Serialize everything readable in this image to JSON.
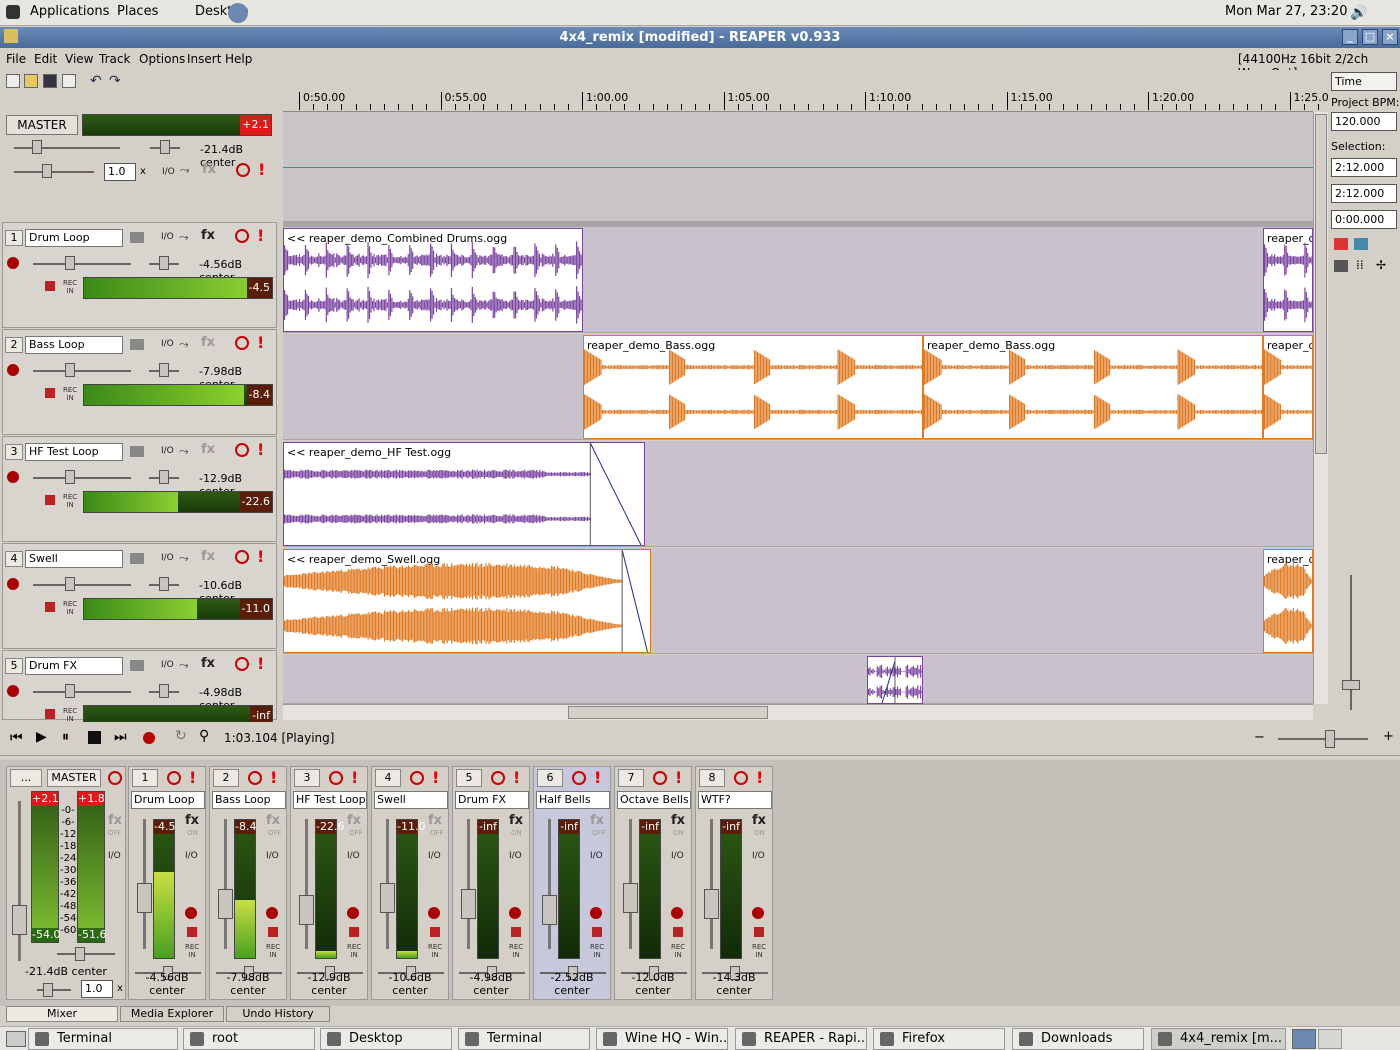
{
  "topbar": {
    "applications": "Applications",
    "places": "Places",
    "desktop": "Desktop",
    "clock": "Mon Mar 27, 23:20"
  },
  "window": {
    "title": "4x4_remix [modified] - REAPER v0.933"
  },
  "menu": {
    "file": "File",
    "edit": "Edit",
    "view": "View",
    "track": "Track",
    "options": "Options",
    "insert": "Insert",
    "help": "Help",
    "audio_info": "[44100Hz 16bit 2/2ch WaveOut]"
  },
  "ruler": {
    "labels": [
      "0:50.00",
      "0:55.00",
      "1:00.00",
      "1:05.00",
      "1:10.00",
      "1:15.00",
      "1:20.00",
      "1:25.00"
    ]
  },
  "right": {
    "mode": "Time",
    "bpm_label": "Project BPM:",
    "bpm": "120.000",
    "selection_label": "Selection:",
    "sel_start": "2:12.000",
    "sel_end": "2:12.000",
    "sel_len": "0:00.000"
  },
  "master": {
    "label": "MASTER",
    "meter": "+2.1",
    "vol": "-21.4dB center",
    "rate": "1.0",
    "x": "x"
  },
  "tracks": [
    {
      "num": "1",
      "name": "Drum Loop",
      "vol": "-4.56dB center",
      "meter": "-4.5",
      "level": 0.9
    },
    {
      "num": "2",
      "name": "Bass Loop",
      "vol": "-7.98dB center",
      "meter": "-8.4",
      "level": 0.85
    },
    {
      "num": "3",
      "name": "HF Test Loop",
      "vol": "-12.9dB center",
      "meter": "-22.6",
      "level": 0.5
    },
    {
      "num": "4",
      "name": "Swell",
      "vol": "-10.6dB center",
      "meter": "-11.0",
      "level": 0.6
    },
    {
      "num": "5",
      "name": "Drum FX",
      "vol": "-4.98dB center",
      "meter": "-inf",
      "level": 0.0
    }
  ],
  "items": {
    "drums": "<< reaper_demo_Combined Drums.ogg",
    "drums_r": "reaper_de",
    "bass1": "reaper_demo_Bass.ogg",
    "bass2": "reaper_demo_Bass.ogg",
    "bass_r": "reaper_de",
    "hf": "<< reaper_demo_HF Test.ogg",
    "swell": "<< reaper_demo_Swell.ogg",
    "swell_r": "reaper_de"
  },
  "transport": {
    "position": "1:03.104 [Playing]"
  },
  "mixer": {
    "master": {
      "btn": "...",
      "label": "MASTER",
      "meter_l": "+2.1",
      "meter_r": "+1.8",
      "scale": [
        "-0-",
        "-6-",
        "-12-",
        "-18-",
        "-24-",
        "-30-",
        "-36-",
        "-42-",
        "-48-",
        "-54-",
        "-60-"
      ],
      "bottom_l": "-54.0",
      "bottom_r": "-51.6",
      "vol": "-21.4dB center",
      "rate": "1.0",
      "x": "x"
    },
    "strips": [
      {
        "num": "1",
        "name": "Drum Loop",
        "meter": "-4.5",
        "vol": "-4.56dB center"
      },
      {
        "num": "2",
        "name": "Bass Loop",
        "meter": "-8.4",
        "vol": "-7.98dB center"
      },
      {
        "num": "3",
        "name": "HF Test Loop",
        "meter": "-22.6",
        "vol": "-12.9dB center"
      },
      {
        "num": "4",
        "name": "Swell",
        "meter": "-11.0",
        "vol": "-10.6dB center"
      },
      {
        "num": "5",
        "name": "Drum FX",
        "meter": "-inf",
        "vol": "-4.98dB center"
      },
      {
        "num": "6",
        "name": "Half Bells",
        "meter": "-inf",
        "vol": "-2.52dB center"
      },
      {
        "num": "7",
        "name": "Octave Bells",
        "meter": "-inf",
        "vol": "-12.0dB center"
      },
      {
        "num": "8",
        "name": "WTF?",
        "meter": "-inf",
        "vol": "-14.3dB center"
      }
    ],
    "tabs": [
      "Mixer",
      "Media Explorer",
      "Undo History"
    ]
  },
  "taskbar": [
    "Terminal",
    "root",
    "Desktop",
    "Terminal",
    "Wine HQ - Win...",
    "REAPER - Rapi...",
    "Firefox",
    "Downloads",
    "4x4_remix [m..."
  ],
  "labels": {
    "io": "I/O",
    "fx": "fx",
    "rec": "REC",
    "in": "IN",
    "on": "ON",
    "off": "OFF"
  },
  "colors": {
    "purple": "#7a44a0",
    "orange": "#e07a22",
    "title": "#4a6a9a"
  }
}
